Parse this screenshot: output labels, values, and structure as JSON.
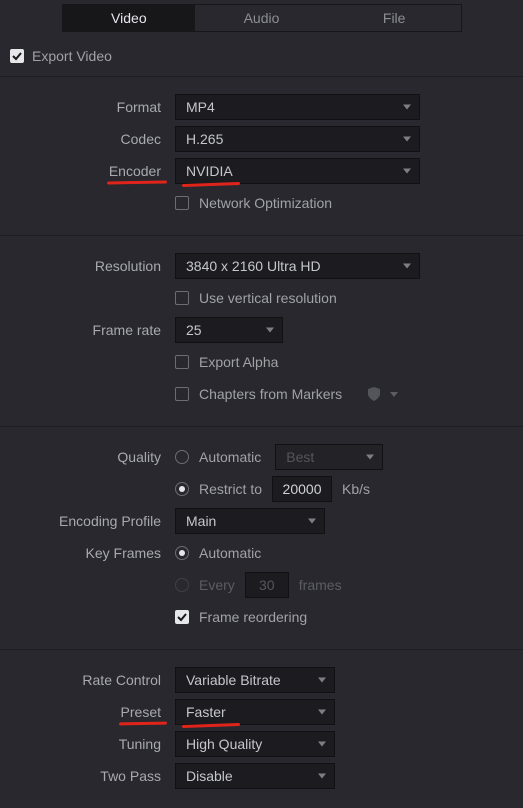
{
  "tabs": {
    "video": "Video",
    "audio": "Audio",
    "file": "File"
  },
  "export_video_label": "Export Video",
  "format": {
    "label": "Format",
    "value": "MP4"
  },
  "codec": {
    "label": "Codec",
    "value": "H.265"
  },
  "encoder": {
    "label": "Encoder",
    "value": "NVIDIA"
  },
  "network_opt_label": "Network Optimization",
  "resolution": {
    "label": "Resolution",
    "value": "3840 x 2160 Ultra HD"
  },
  "vertical_res_label": "Use vertical resolution",
  "frame_rate": {
    "label": "Frame rate",
    "value": "25"
  },
  "export_alpha_label": "Export Alpha",
  "chapters_label": "Chapters from Markers",
  "quality": {
    "label": "Quality",
    "automatic_label": "Automatic",
    "auto_value": "Best",
    "restrict_label": "Restrict to",
    "restrict_value": "20000",
    "unit": "Kb/s"
  },
  "enc_profile": {
    "label": "Encoding Profile",
    "value": "Main"
  },
  "key_frames": {
    "label": "Key Frames",
    "automatic_label": "Automatic",
    "every_label": "Every",
    "every_value": "30",
    "frames_label": "frames"
  },
  "frame_reorder_label": "Frame reordering",
  "rate_control": {
    "label": "Rate Control",
    "value": "Variable Bitrate"
  },
  "preset": {
    "label": "Preset",
    "value": "Faster"
  },
  "tuning": {
    "label": "Tuning",
    "value": "High Quality"
  },
  "two_pass": {
    "label": "Two Pass",
    "value": "Disable"
  }
}
